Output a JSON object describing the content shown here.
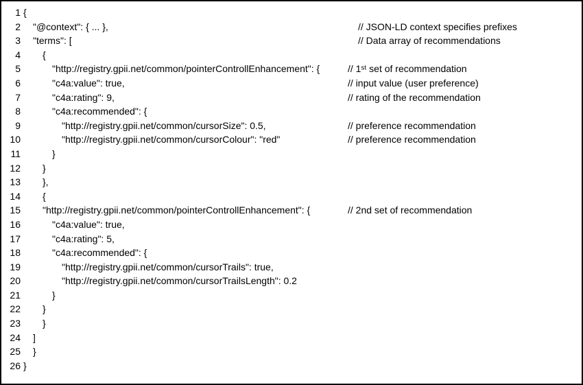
{
  "lines": [
    {
      "n": "1",
      "indent": 0,
      "code": "{",
      "cpos": "",
      "comment": ""
    },
    {
      "n": "2",
      "indent": 1,
      "code": "\"@context\": { ... },",
      "cpos": "c520",
      "comment": "// JSON-LD context specifies prefixes"
    },
    {
      "n": "3",
      "indent": 1,
      "code": "\"terms\": [",
      "cpos": "c520",
      "comment": "// Data array of recommendations"
    },
    {
      "n": "4",
      "indent": 2,
      "code": "{",
      "cpos": "",
      "comment": ""
    },
    {
      "n": "5",
      "indent": 3,
      "code": "\"http://registry.gpii.net/common/pointerControllEnhancement\": {",
      "cpos": "c505",
      "comment": "// 1ˢᵗ set of recommendation"
    },
    {
      "n": "6",
      "indent": 3,
      "code": "\"c4a:value\": true,",
      "cpos": "c505",
      "comment": "// input value (user preference)"
    },
    {
      "n": "7",
      "indent": 3,
      "code": "\"c4a:rating\": 9,",
      "cpos": "c505",
      "comment": "// rating of the recommendation"
    },
    {
      "n": "8",
      "indent": 3,
      "code": "\"c4a:recommended\": {",
      "cpos": "",
      "comment": ""
    },
    {
      "n": "9",
      "indent": 4,
      "code": "\"http://registry.gpii.net/common/cursorSize\": 0.5,",
      "cpos": "c505",
      "comment": "// preference recommendation"
    },
    {
      "n": "10",
      "indent": 4,
      "code": "\"http://registry.gpii.net/common/cursorColour\": \"red\"",
      "cpos": "c505",
      "comment": "// preference recommendation"
    },
    {
      "n": "11",
      "indent": 3,
      "code": "}",
      "cpos": "",
      "comment": ""
    },
    {
      "n": "12",
      "indent": 2,
      "code": "}",
      "cpos": "",
      "comment": ""
    },
    {
      "n": "13",
      "indent": 2,
      "code": "},",
      "cpos": "",
      "comment": ""
    },
    {
      "n": "14",
      "indent": 2,
      "code": "{",
      "cpos": "",
      "comment": ""
    },
    {
      "n": "15",
      "indent": 2,
      "code": "\"http://registry.gpii.net/common/pointerControllEnhancement\": {",
      "cpos": "c505",
      "comment": "// 2nd set of recommendation"
    },
    {
      "n": "16",
      "indent": 3,
      "code": "\"c4a:value\": true,",
      "cpos": "",
      "comment": ""
    },
    {
      "n": "17",
      "indent": 3,
      "code": "\"c4a:rating\": 5,",
      "cpos": "",
      "comment": ""
    },
    {
      "n": "18",
      "indent": 3,
      "code": "\"c4a:recommended\": {",
      "cpos": "",
      "comment": ""
    },
    {
      "n": "19",
      "indent": 4,
      "code": "\"http://registry.gpii.net/common/cursorTrails\": true,",
      "cpos": "",
      "comment": ""
    },
    {
      "n": "20",
      "indent": 4,
      "code": "\"http://registry.gpii.net/common/cursorTrailsLength\": 0.2",
      "cpos": "",
      "comment": ""
    },
    {
      "n": "21",
      "indent": 3,
      "code": "}",
      "cpos": "",
      "comment": ""
    },
    {
      "n": "22",
      "indent": 2,
      "code": "}",
      "cpos": "",
      "comment": ""
    },
    {
      "n": "23",
      "indent": 2,
      "code": "}",
      "cpos": "",
      "comment": ""
    },
    {
      "n": "24",
      "indent": 1,
      "code": "]",
      "cpos": "",
      "comment": ""
    },
    {
      "n": "25",
      "indent": 1,
      "code": "}",
      "cpos": "",
      "comment": ""
    },
    {
      "n": "26",
      "indent": 0,
      "code": "}",
      "cpos": "",
      "comment": ""
    }
  ]
}
